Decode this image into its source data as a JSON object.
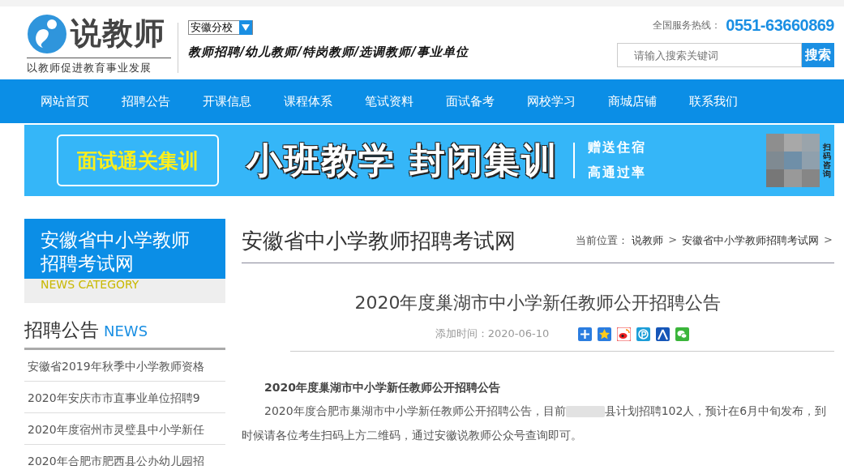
{
  "header": {
    "logo_text": "说教师",
    "slogan": "以教师促进教育事业发展",
    "branch_select": {
      "value": "安徽分校"
    },
    "tagline": "教师招聘/幼儿教师/特岗教师/选调教师/事业单位",
    "hotline": {
      "label": "全国服务热线：",
      "number": "0551-63660869"
    },
    "search": {
      "placeholder": "请输入搜索关键词",
      "button": "搜索"
    }
  },
  "nav": [
    "网站首页",
    "招聘公告",
    "开课信息",
    "课程体系",
    "笔试资料",
    "面试备考",
    "网校学习",
    "商城店铺",
    "联系我们"
  ],
  "banner": {
    "badge": "面试通关集训",
    "headline": "小班教学 封闭集训",
    "perks": [
      "赠送住宿",
      "高通过率"
    ],
    "qr_caption": "扫码咨询"
  },
  "sidebar": {
    "title": "安徽省中小学教师招聘考试网",
    "subtitle": "NEWS CATEGORY",
    "section_title": "招聘公告",
    "section_en": "NEWS",
    "items": [
      "安徽省2019年秋季中小学教师资格",
      "2020年安庆市市直事业单位招聘9",
      "2020年度宿州市灵璧县中小学新任",
      "2020年合肥市肥西县公办幼儿园招"
    ]
  },
  "main": {
    "page_title": "安徽省中小学教师招聘考试网",
    "breadcrumb": [
      {
        "kind": "label",
        "text": "当前位置："
      },
      {
        "kind": "link",
        "text": "说教师"
      },
      {
        "kind": "separator",
        "text": ">"
      },
      {
        "kind": "link",
        "text": "安徽省中小学教师招聘考试网"
      },
      {
        "kind": "separator",
        "text": ">"
      }
    ],
    "article": {
      "title": "2020年度巢湖市中小学新任教师公开招聘公告",
      "date_label": "添加时间：",
      "date": "2020-06-10",
      "heading": "2020年度巢湖市中小学新任教师公开招聘公告",
      "paragraph_start": "2020年度合肥市巢湖市中小学新任教师公开招聘公告，目前",
      "paragraph_end": "县计划招聘102人，预计在6月中旬发布，到时候请各位考生扫码上方二维码，通过安徽说教师公众号查询即可。"
    }
  }
}
